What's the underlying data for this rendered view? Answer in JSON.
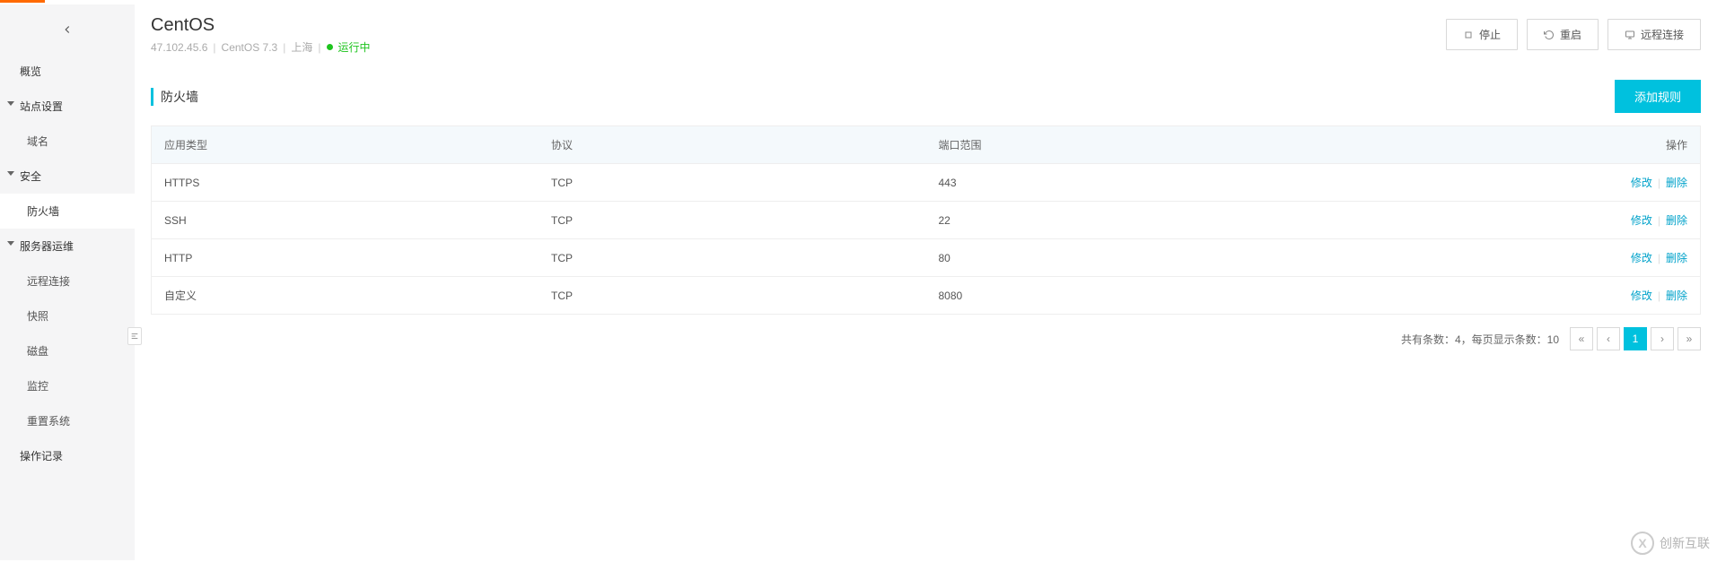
{
  "header": {
    "server_name": "CentOS",
    "ip": "47.102.45.6",
    "os": "CentOS 7.3",
    "region": "上海",
    "status_text": "运行中",
    "actions": {
      "stop": "停止",
      "restart": "重启",
      "remote": "远程连接"
    }
  },
  "sidebar": {
    "overview": "概览",
    "site_settings": "站点设置",
    "domain": "域名",
    "security": "安全",
    "firewall": "防火墙",
    "server_ops": "服务器运维",
    "remote_connect": "远程连接",
    "snapshot": "快照",
    "disk": "磁盘",
    "monitor": "监控",
    "reset_system": "重置系统",
    "operation_log": "操作记录"
  },
  "section": {
    "title": "防火墙",
    "add_rule": "添加规则"
  },
  "table": {
    "headers": {
      "app_type": "应用类型",
      "protocol": "协议",
      "port_range": "端口范围",
      "action": "操作"
    },
    "row_actions": {
      "edit": "修改",
      "delete": "删除"
    },
    "rows": [
      {
        "app_type": "HTTPS",
        "protocol": "TCP",
        "port_range": "443"
      },
      {
        "app_type": "SSH",
        "protocol": "TCP",
        "port_range": "22"
      },
      {
        "app_type": "HTTP",
        "protocol": "TCP",
        "port_range": "80"
      },
      {
        "app_type": "自定义",
        "protocol": "TCP",
        "port_range": "8080"
      }
    ]
  },
  "pager": {
    "summary": "共有条数：4，每页显示条数：10",
    "first": "«",
    "prev": "‹",
    "page1": "1",
    "next": "›",
    "last": "»"
  },
  "watermark": {
    "icon_text": "X",
    "text": "创新互联"
  }
}
